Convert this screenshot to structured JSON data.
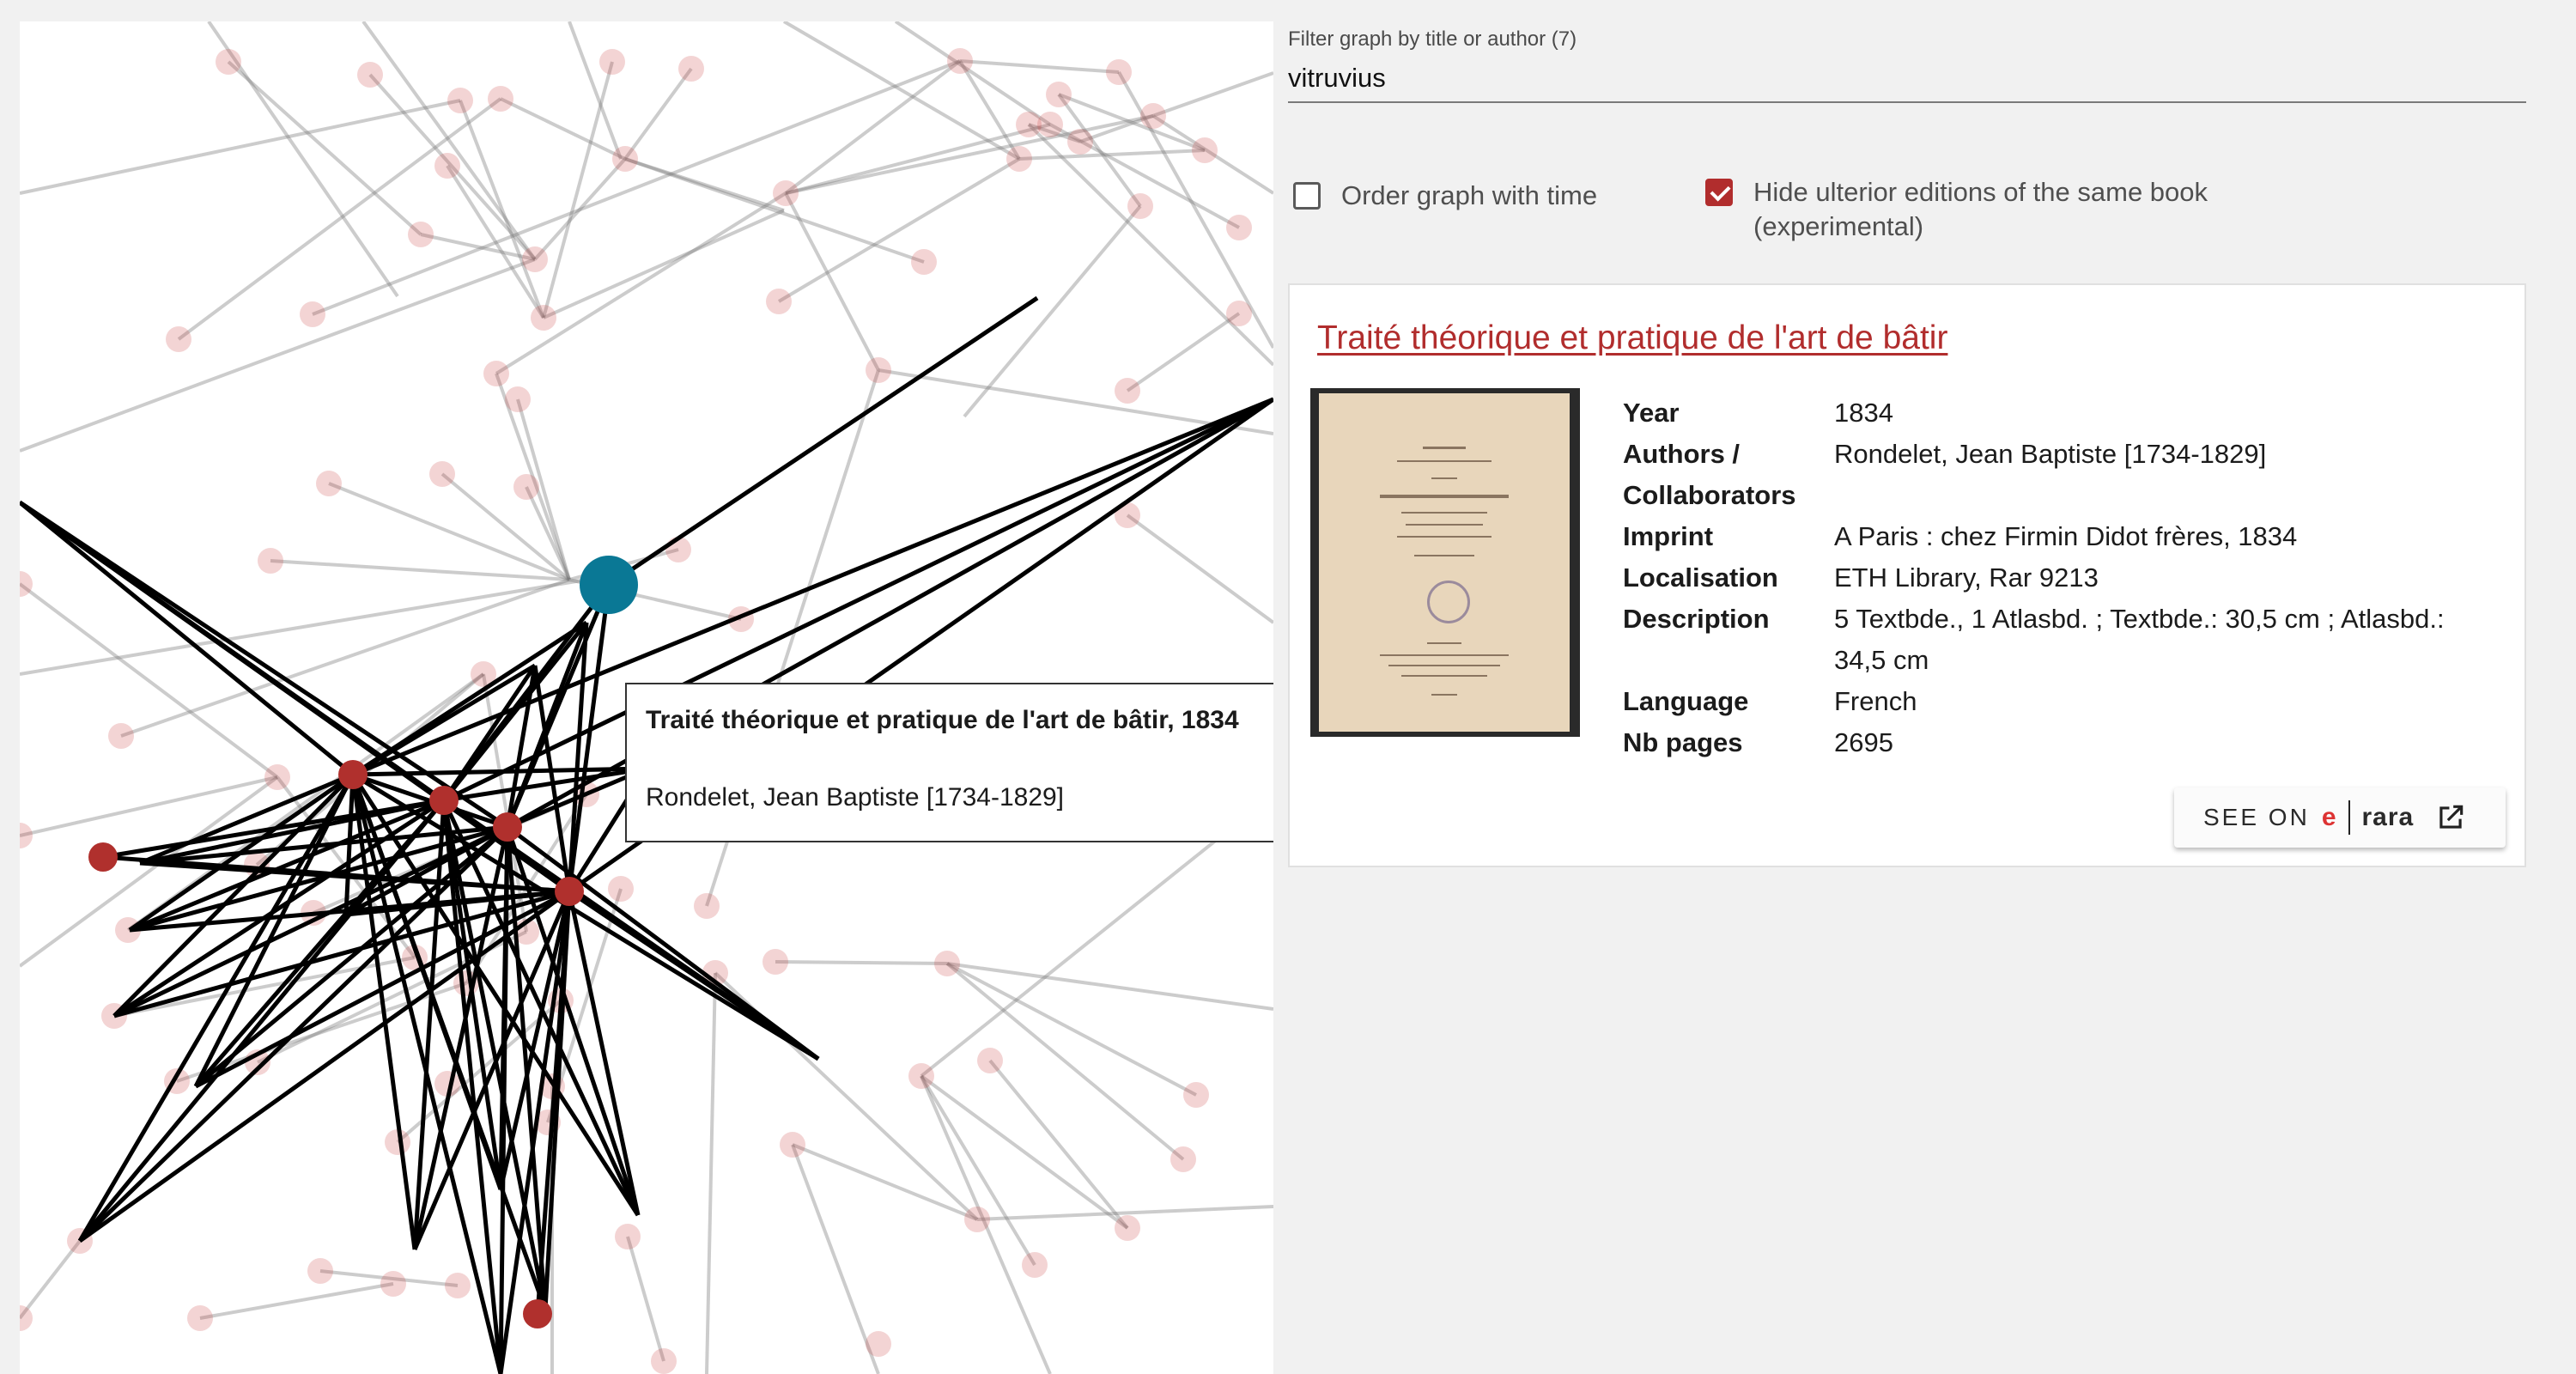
{
  "filter": {
    "label": "Filter graph by title or author (7)",
    "value": "vitruvius"
  },
  "options": {
    "order_time_label": "Order graph with time",
    "order_time_checked": false,
    "hide_editions_label": "Hide ulterior editions of the same book (experimental)",
    "hide_editions_checked": true
  },
  "tooltip": {
    "title": "Traité théorique et pratique de l'art de bâtir, 1834",
    "author": "Rondelet, Jean Baptiste [1734-1829]"
  },
  "book": {
    "title": "Traité théorique et pratique de l'art de bâtir",
    "thumbnail_icon": "book-cover-image",
    "fields": [
      {
        "key": "Year",
        "value": "1834"
      },
      {
        "key": "Authors / Collaborators",
        "value": "Rondelet, Jean Baptiste [1734-1829]"
      },
      {
        "key": "Imprint",
        "value": "A Paris : chez Firmin Didot frères, 1834"
      },
      {
        "key": "Localisation",
        "value": "ETH Library, Rar 9213"
      },
      {
        "key": "Description",
        "value": "5 Textbde., 1 Atlasbd. ; Textbde.: 30,5 cm ; Atlasbd.: 34,5 cm"
      },
      {
        "key": "Language",
        "value": "French"
      },
      {
        "key": "Nb pages",
        "value": "2695"
      }
    ]
  },
  "see_on": {
    "label": "SEE ON",
    "logo_e": "e",
    "logo_rara": "rara",
    "icon": "external-link-icon"
  },
  "colors": {
    "accent": "#b12d2d",
    "selected_node": "#0a7895",
    "highlight_node": "#b0302d",
    "edge": "#7a7a7a"
  }
}
